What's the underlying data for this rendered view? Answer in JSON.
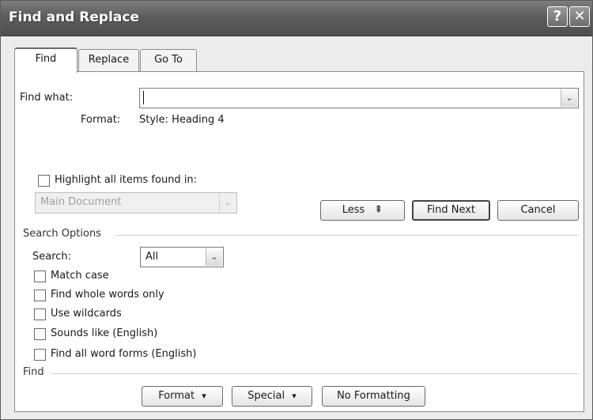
{
  "window": {
    "title": "Find and Replace",
    "help_glyph": "?",
    "close_glyph": "✕"
  },
  "tabs": [
    {
      "label": "Find",
      "active": true
    },
    {
      "label": "Replace",
      "active": false
    },
    {
      "label": "Go To",
      "active": false
    }
  ],
  "find_what": {
    "label": "Find what:",
    "value": "",
    "arrow": "⌄"
  },
  "format": {
    "label": "Format:",
    "value": "Style: Heading 4"
  },
  "highlight": {
    "label": "Highlight all items found in:",
    "checked": false,
    "dropdown_value": "Main Document",
    "arrow": "⌄"
  },
  "actions": {
    "less": "Less",
    "less_icon": "⇞",
    "find_next": "Find Next",
    "cancel": "Cancel"
  },
  "search_options": {
    "group_title": "Search Options",
    "search_label": "Search:",
    "search_value": "All",
    "search_arrow": "⌄",
    "options": [
      {
        "label": "Match case",
        "checked": false
      },
      {
        "label": "Find whole words only",
        "checked": false
      },
      {
        "label": "Use wildcards",
        "checked": false
      },
      {
        "label": "Sounds like (English)",
        "checked": false
      },
      {
        "label": "Find all word forms (English)",
        "checked": false
      }
    ]
  },
  "find_group": {
    "title": "Find",
    "format_button": "Format",
    "special_button": "Special",
    "no_formatting_button": "No Formatting",
    "menu_arrow": "▾"
  }
}
